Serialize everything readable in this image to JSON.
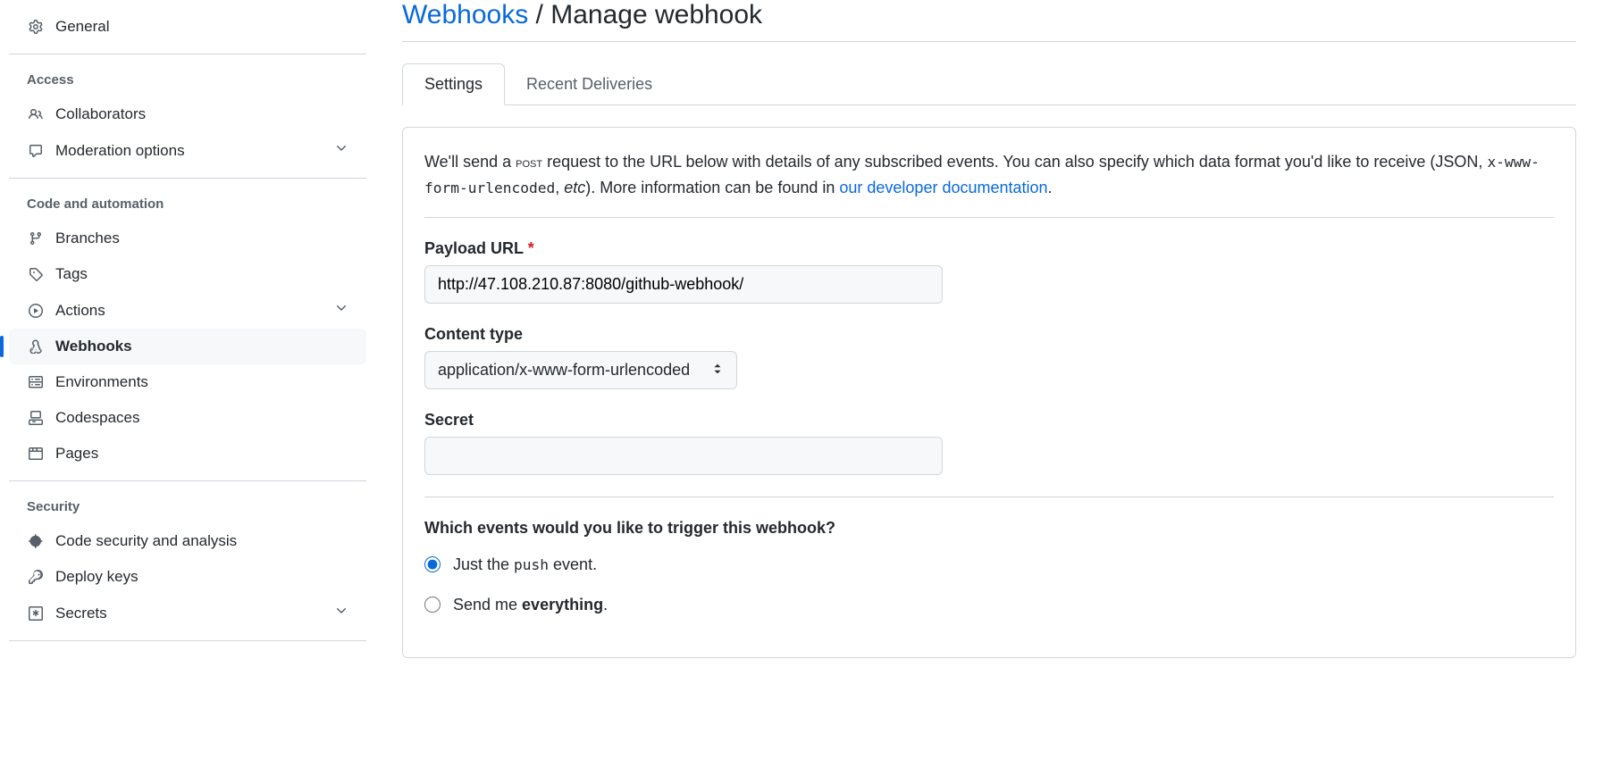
{
  "sidebar": {
    "general": "General",
    "access_heading": "Access",
    "collaborators": "Collaborators",
    "moderation": "Moderation options",
    "code_heading": "Code and automation",
    "branches": "Branches",
    "tags": "Tags",
    "actions": "Actions",
    "webhooks": "Webhooks",
    "environments": "Environments",
    "codespaces": "Codespaces",
    "pages": "Pages",
    "security_heading": "Security",
    "code_security": "Code security and analysis",
    "deploy_keys": "Deploy keys",
    "secrets": "Secrets"
  },
  "breadcrumb": {
    "parent": "Webhooks",
    "sep": " / ",
    "current": "Manage webhook"
  },
  "tabs": {
    "settings": "Settings",
    "recent": "Recent Deliveries"
  },
  "desc": {
    "t1": "We'll send a ",
    "post": "post",
    "t2": " request to the URL below with details of any subscribed events. You can also specify which data format you'd like to receive (JSON, ",
    "code": "x-www-form-urlencoded",
    "t3": ", ",
    "etc": "etc",
    "t4": "). More information can be found in ",
    "link": "our developer documentation",
    "t5": "."
  },
  "form": {
    "payload_label": "Payload URL",
    "required": "*",
    "payload_value": "http://47.108.210.87:8080/github-webhook/",
    "content_type_label": "Content type",
    "content_type_value": "application/x-www-form-urlencoded",
    "secret_label": "Secret",
    "secret_value": ""
  },
  "events": {
    "heading": "Which events would you like to trigger this webhook?",
    "opt1_a": "Just the ",
    "opt1_code": "push",
    "opt1_b": " event.",
    "opt2_a": "Send me ",
    "opt2_b": "everything",
    "opt2_c": "."
  }
}
